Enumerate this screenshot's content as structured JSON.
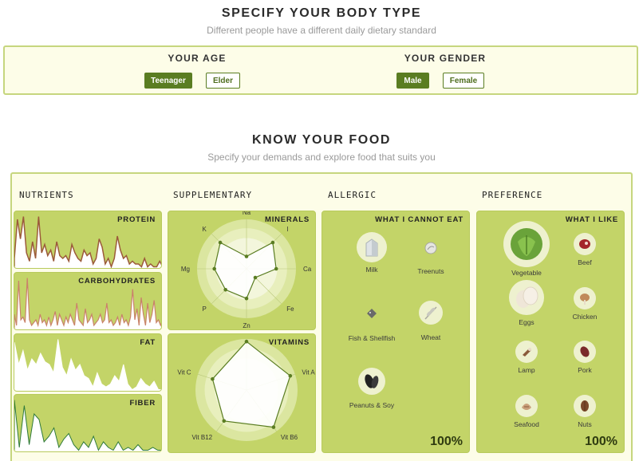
{
  "body_type": {
    "title": "SPECIFY YOUR BODY TYPE",
    "subtitle": "Different people have a different daily dietary standard",
    "age": {
      "title": "YOUR AGE",
      "options": [
        {
          "label": "Teenager",
          "selected": true
        },
        {
          "label": "Elder",
          "selected": false
        }
      ]
    },
    "gender": {
      "title": "YOUR GENDER",
      "options": [
        {
          "label": "Male",
          "selected": true
        },
        {
          "label": "Female",
          "selected": false
        }
      ]
    }
  },
  "food": {
    "title": "KNOW YOUR FOOD",
    "subtitle": "Specify your demands and explore food that suits you",
    "columns": {
      "nutrients": "NUTRIENTS",
      "supplementary": "SUPPLEMENTARY",
      "allergic": "ALLERGIC",
      "preference": "PREFERENCE"
    }
  },
  "nutrients": {
    "protein": {
      "label": "PROTEIN",
      "values": [
        0.2,
        0.9,
        0.55,
        0.95,
        0.3,
        0.15,
        0.5,
        0.2,
        0.95,
        0.3,
        0.45,
        0.25,
        0.35,
        0.15,
        0.5,
        0.25,
        0.2,
        0.25,
        0.15,
        0.45,
        0.3,
        0.2,
        0.15,
        0.35,
        0.25,
        0.3,
        0.1,
        0.2,
        0.55,
        0.4,
        0.1,
        0.2,
        0.05,
        0.2,
        0.6,
        0.35,
        0.2,
        0.25,
        0.1,
        0.15,
        0.1,
        0.1,
        0.05,
        0.2,
        0.05,
        0.1,
        0.05,
        0.05,
        0.15,
        0.05
      ]
    },
    "carbohydrates": {
      "label": "CARBOHYDRATES",
      "values": [
        0.3,
        0.1,
        0.9,
        0.2,
        0.25,
        0.15,
        0.95,
        0.2,
        0.1,
        0.15,
        0.2,
        0.1,
        0.3,
        0.15,
        0.2,
        0.1,
        0.25,
        0.1,
        0.2,
        0.35,
        0.1,
        0.3,
        0.2,
        0.1,
        0.25,
        0.15,
        0.3,
        0.2,
        0.1,
        0.5,
        0.2,
        0.15,
        0.1,
        0.4,
        0.15,
        0.2,
        0.3,
        0.1,
        0.15,
        0.2,
        0.3,
        0.15,
        0.2,
        0.5,
        0.15,
        0.2,
        0.1,
        0.15,
        0.25,
        0.1,
        0.3,
        0.15,
        0.2,
        0.1,
        0.25,
        0.75,
        0.2,
        0.4,
        0.1,
        0.6,
        0.3,
        0.1,
        0.5,
        0.15,
        0.3,
        0.55,
        0.15,
        0.2,
        0.1,
        0.2
      ]
    },
    "fat": {
      "label": "FAT",
      "values": [
        0.9,
        0.5,
        0.75,
        0.4,
        0.6,
        0.5,
        0.7,
        0.55,
        0.5,
        0.35,
        0.95,
        0.45,
        0.3,
        0.6,
        0.4,
        0.5,
        0.3,
        0.25,
        0.1,
        0.35,
        0.15,
        0.1,
        0.15,
        0.3,
        0.2,
        0.5,
        0.15,
        0.05,
        0.1,
        0.25,
        0.15,
        0.1,
        0.2,
        0.05,
        0.05
      ]
    },
    "fiber": {
      "label": "FIBER",
      "values": [
        0.95,
        0.1,
        0.85,
        0.15,
        0.7,
        0.6,
        0.2,
        0.3,
        0.45,
        0.1,
        0.25,
        0.35,
        0.15,
        0.05,
        0.2,
        0.1,
        0.3,
        0.05,
        0.2,
        0.1,
        0.05,
        0.2,
        0.05,
        0.1,
        0.05,
        0.15,
        0.05,
        0.05,
        0.1,
        0.05,
        0.05
      ]
    }
  },
  "supplementary": {
    "minerals": {
      "label": "MINERALS",
      "axes": [
        "Na",
        "I",
        "Ca",
        "Fe",
        "Zn",
        "P",
        "Mg",
        "K"
      ],
      "values": [
        0.25,
        0.75,
        0.6,
        0.25,
        0.6,
        0.6,
        0.65,
        0.75
      ]
    },
    "vitamins": {
      "label": "VITAMINS",
      "axes": [
        "Vit D",
        "Vit A",
        "Vit B6",
        "Vit B12",
        "Vit C"
      ],
      "values": [
        0.95,
        0.9,
        0.9,
        0.75,
        0.7
      ]
    }
  },
  "allergic": {
    "title": "WHAT I CANNOT EAT",
    "items": [
      {
        "name": "Milk",
        "icon": "milk-icon"
      },
      {
        "name": "Treenuts",
        "icon": "treenuts-icon"
      },
      {
        "name": "Fish & Shellfish",
        "icon": "fish-icon"
      },
      {
        "name": "Wheat",
        "icon": "wheat-icon"
      },
      {
        "name": "Peanuts & Soy",
        "icon": "peanuts-icon"
      }
    ],
    "percent": "100%"
  },
  "preference": {
    "title": "WHAT I LIKE",
    "items": [
      {
        "name": "Vegetable",
        "icon": "vegetable-icon"
      },
      {
        "name": "Beef",
        "icon": "beef-icon"
      },
      {
        "name": "Eggs",
        "icon": "eggs-icon"
      },
      {
        "name": "Chicken",
        "icon": "chicken-icon"
      },
      {
        "name": "Lamp",
        "icon": "lamb-icon"
      },
      {
        "name": "Pork",
        "icon": "pork-icon"
      },
      {
        "name": "Seafood",
        "icon": "seafood-icon"
      },
      {
        "name": "Nuts",
        "icon": "nuts-icon"
      }
    ],
    "percent": "100%"
  },
  "colors": {
    "accent": "#5a7d22",
    "card": "#c3d468",
    "panel_border": "#c6d67e",
    "protein_line": "#9b5a3a",
    "carb_line": "#c9826a",
    "fiber_line": "#2f7a3a"
  }
}
